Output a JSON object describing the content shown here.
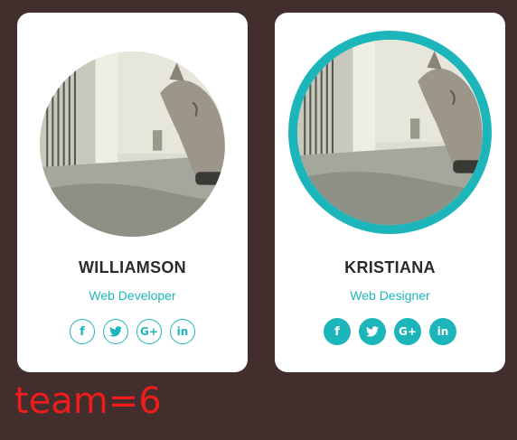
{
  "members": [
    {
      "name": "WILLIAMSON",
      "role": "Web Developer",
      "photo_icon": "cat-photo",
      "social_style": "outline",
      "socials": [
        {
          "icon": "facebook-icon",
          "glyph": "f"
        },
        {
          "icon": "twitter-icon",
          "glyph": ""
        },
        {
          "icon": "google-plus-icon",
          "glyph": "G+"
        },
        {
          "icon": "linkedin-icon",
          "glyph": "in"
        }
      ]
    },
    {
      "name": "KRISTIANA",
      "role": "Web Designer",
      "photo_icon": "cat-photo",
      "social_style": "filled",
      "socials": [
        {
          "icon": "facebook-icon",
          "glyph": "f"
        },
        {
          "icon": "twitter-icon",
          "glyph": ""
        },
        {
          "icon": "google-plus-icon",
          "glyph": "G+"
        },
        {
          "icon": "linkedin-icon",
          "glyph": "in"
        }
      ]
    }
  ],
  "overlay_label": "team=6",
  "colors": {
    "background": "#422e2d",
    "card": "#ffffff",
    "accent": "#1bb5ba",
    "name_text": "#2b2b2b",
    "overlay_text": "#ee1c1c"
  }
}
